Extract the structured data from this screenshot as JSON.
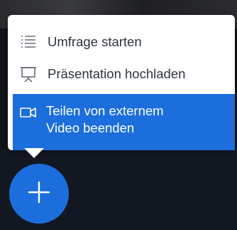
{
  "colors": {
    "accent": "#1b6edc",
    "menu_background": "#ffffff",
    "menu_text": "#2d3340",
    "selected_text": "#ffffff"
  },
  "menu": {
    "items": [
      {
        "label": "Umfrage starten",
        "icon": "poll-list-icon"
      },
      {
        "label": "Präsentation hochladen",
        "icon": "presentation-icon"
      },
      {
        "label_lines": [
          "Teilen von externem",
          "Video beenden"
        ],
        "icon": "external-video-icon",
        "selected": true
      }
    ]
  },
  "fab": {
    "icon": "plus-icon"
  }
}
